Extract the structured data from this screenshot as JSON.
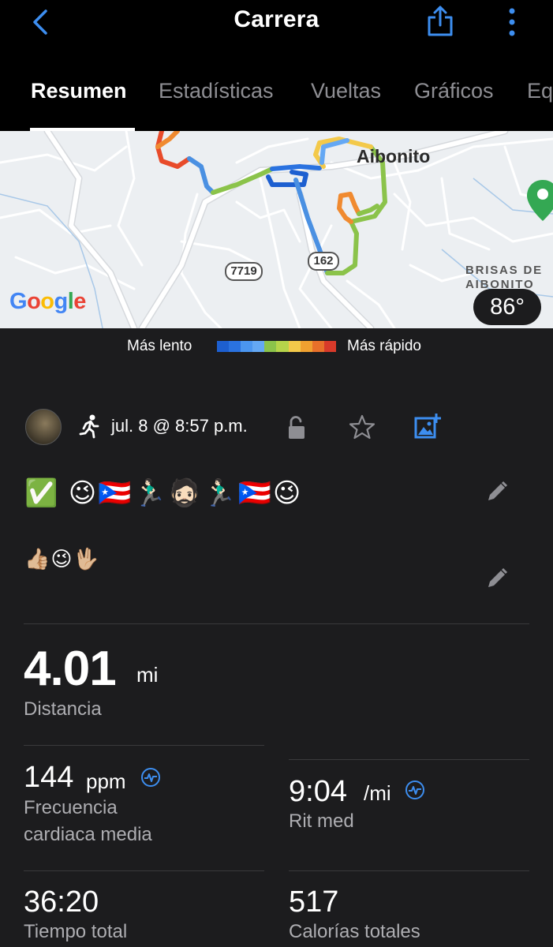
{
  "header": {
    "title": "Carrera",
    "tabs": [
      "Resumen",
      "Estadísticas",
      "Vueltas",
      "Gráficos",
      "Eq"
    ]
  },
  "map": {
    "town_label": "Aibonito",
    "district_label_1": "BRISAS DE",
    "district_label_2": "AIBONITO",
    "road_1": "7719",
    "road_2": "162",
    "google_logo": "Google",
    "temperature": "86°"
  },
  "legend": {
    "slow": "Más lento",
    "fast": "Más rápido",
    "colors": [
      "#1d5fd0",
      "#2a72e0",
      "#4b96f0",
      "#64a8f4",
      "#8bc34a",
      "#b6d44a",
      "#f3c94a",
      "#f0a030",
      "#e8702a",
      "#d83a2a"
    ]
  },
  "activity": {
    "date": "jul. 8 @ 8:57 p.m.",
    "title_emojis": "✅ 😉🇵🇷🏃🏻‍♂️🧔🏻🏃🏻‍♂️🇵🇷😉",
    "description_emojis": "👍🏼😉🖖🏼"
  },
  "stats": {
    "distance": {
      "value": "4.01",
      "unit": "mi",
      "label": "Distancia"
    },
    "heart_rate": {
      "value": "144",
      "unit": "ppm",
      "label_1": "Frecuencia",
      "label_2": "cardiaca media"
    },
    "pace": {
      "value": "9:04",
      "unit": "/mi",
      "label": "Rit med"
    },
    "time": {
      "value": "36:20",
      "label": "Tiempo total"
    },
    "calories": {
      "value": "517",
      "label": "Calorías totales"
    }
  },
  "colors": {
    "accent": "#3d8ef0",
    "background": "#1c1c1e",
    "header": "#000000"
  }
}
